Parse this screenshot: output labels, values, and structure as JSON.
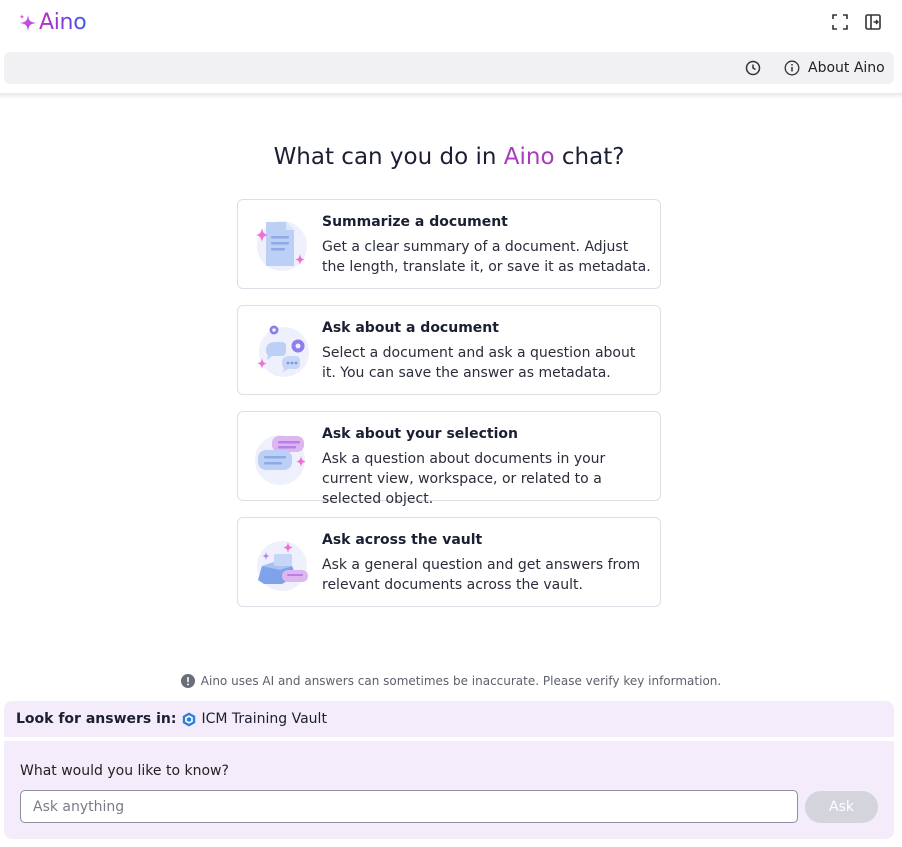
{
  "app": {
    "name": "Aino"
  },
  "header": {
    "fullscreen_icon": "expand-icon",
    "panel_icon": "dock-panel-icon"
  },
  "toolbar": {
    "history_icon": "clock-icon",
    "about_label": "About Aino"
  },
  "main": {
    "heading_pre": "What can you do in",
    "heading_brand": "Aino",
    "heading_post": "chat?",
    "cards": [
      {
        "title": "Summarize a document",
        "description": "Get a clear summary of a document. Adjust the length, translate it, or save it as metadata.",
        "icon": "document-summary-illustration"
      },
      {
        "title": "Ask about a document",
        "description": "Select a document and ask a question about it. You can save the answer as metadata.",
        "icon": "document-question-illustration"
      },
      {
        "title": "Ask about your selection",
        "description": "Ask a question about documents in your current view, workspace, or related to a selected object.",
        "icon": "selection-chat-illustration"
      },
      {
        "title": "Ask across the vault",
        "description": "Ask a general question and get answers from relevant documents across the vault.",
        "icon": "vault-search-illustration"
      }
    ]
  },
  "disclaimer": "Aino uses AI and answers can sometimes be inaccurate. Please verify key information.",
  "scope": {
    "label": "Look for answers in:",
    "vault": "ICM Training Vault"
  },
  "ask": {
    "prompt": "What would you like to know?",
    "placeholder": "Ask anything",
    "button_label": "Ask"
  },
  "colors": {
    "brand": "#a63bbf",
    "panel_bg": "#f4ecfa",
    "ask_button_disabled": "#d4d5dc"
  }
}
